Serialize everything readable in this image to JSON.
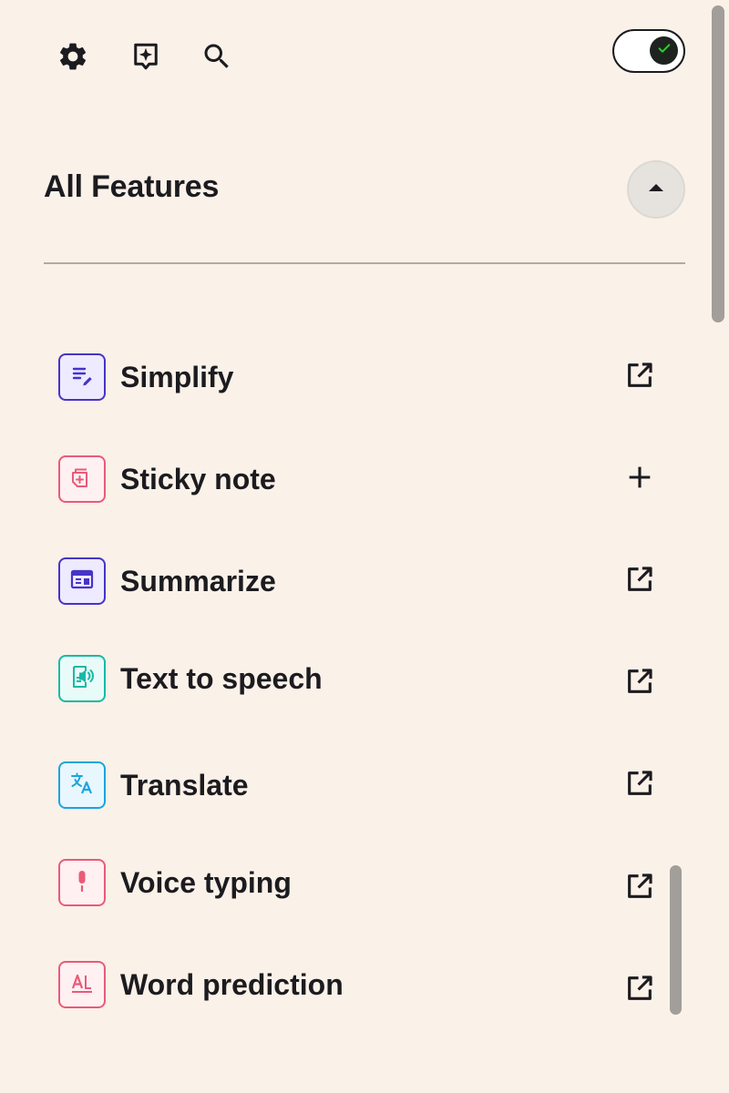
{
  "toolbar": {
    "settings_icon": "gear-icon",
    "ai_icon": "sparkle-chat-icon",
    "search_icon": "search-icon",
    "toggle_state": "on",
    "toggle_icon": "check-icon"
  },
  "header": {
    "title": "All Features",
    "collapse_icon": "caret-up-icon"
  },
  "colors": {
    "background": "#faf1e9",
    "text": "#1c1b1f",
    "indigo": "#4534c8",
    "pink": "#ea5a78",
    "teal": "#19b9a6",
    "sky": "#1aa5df",
    "toggle_check": "#2bd12b"
  },
  "features": [
    {
      "label": "Simplify",
      "icon": "simplify-icon",
      "color": "#4534c8",
      "tint": "#eeeaff",
      "action": "open-external-icon"
    },
    {
      "label": "Sticky note",
      "icon": "sticky-note-icon",
      "color": "#ea5a78",
      "tint": "#fff0f2",
      "action": "plus-icon"
    },
    {
      "label": "Summarize",
      "icon": "summarize-icon",
      "color": "#4534c8",
      "tint": "#eeeaff",
      "action": "open-external-icon"
    },
    {
      "label": "Text to speech",
      "icon": "text-to-speech-icon",
      "color": "#19b9a6",
      "tint": "#e8fbf8",
      "action": "open-external-icon"
    },
    {
      "label": "Translate",
      "icon": "translate-icon",
      "color": "#1aa5df",
      "tint": "#e8f7fd",
      "action": "open-external-icon"
    },
    {
      "label": "Voice typing",
      "icon": "microphone-icon",
      "color": "#ea5a78",
      "tint": "#fff0f2",
      "action": "open-external-icon"
    },
    {
      "label": "Word prediction",
      "icon": "word-prediction-icon",
      "color": "#ea5a78",
      "tint": "#fff0f2",
      "action": "open-external-icon"
    }
  ]
}
